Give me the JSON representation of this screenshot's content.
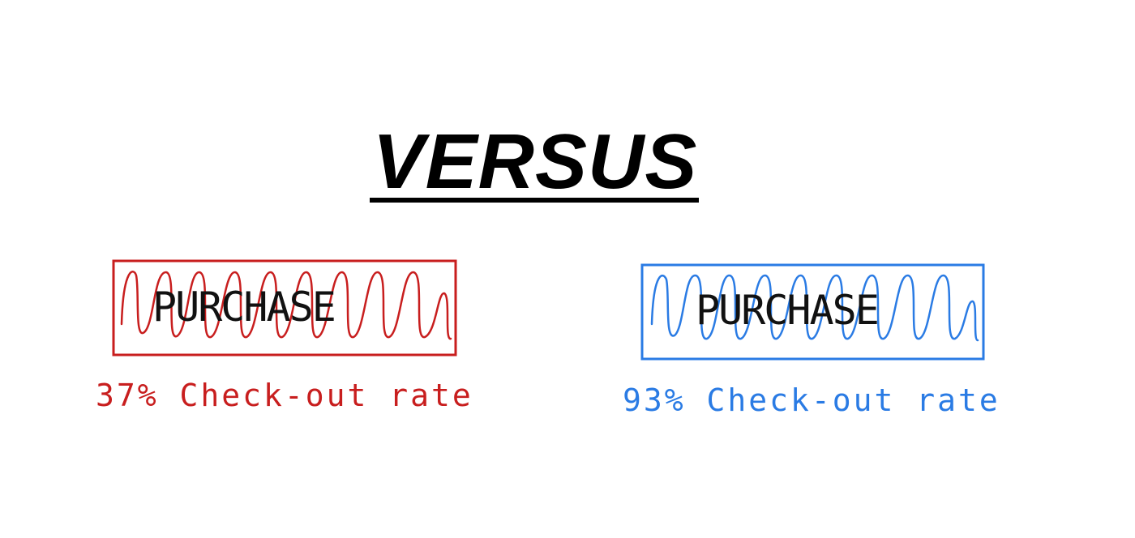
{
  "heading": {
    "title": "VERSUS"
  },
  "variants": [
    {
      "button_label": "PURCHASE",
      "rate_text": "37% Check-out rate",
      "color": "#c81e1e"
    },
    {
      "button_label": "PURCHASE",
      "rate_text": "93% Check-out rate",
      "color": "#2a7be4"
    }
  ]
}
